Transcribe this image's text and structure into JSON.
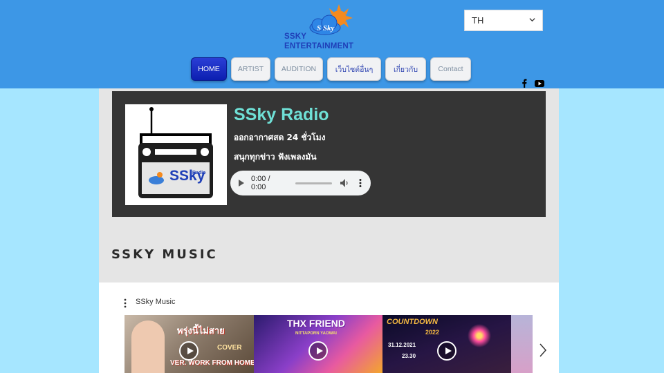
{
  "header": {
    "logo_badge": "S Sky",
    "logo_line1": "SSKY",
    "logo_line2": "ENTERTAINMENT",
    "language": "TH",
    "colors": {
      "header_bg": "#3d97e6",
      "active_nav": "#1a2fc4",
      "page_bg": "#a6e6ff"
    }
  },
  "nav": {
    "items": [
      {
        "label": "HOME",
        "active": true
      },
      {
        "label": "ARTIST"
      },
      {
        "label": "AUDITION"
      },
      {
        "label": "เว็บไซต์อื่นๆ"
      },
      {
        "label": "เกี่ยวกับ"
      },
      {
        "label": "Contact"
      }
    ]
  },
  "social": {
    "icons": [
      "facebook-icon",
      "youtube-icon"
    ]
  },
  "radio": {
    "title": "SSky Radio",
    "line1": "ออกอากาศสด 24 ชั่วโมง",
    "line2": "สนุกทุกข่าว ฟังเพลงมัน",
    "image_text": "SSky",
    "image_small_text": "Radio",
    "player_time": "0:00 / 0:00"
  },
  "music": {
    "section_title": "SSKY MUSIC",
    "playlist_label": "SSky Music",
    "videos": [
      {
        "title": "พรุ่งนี้ไม่สาย",
        "sub1": "COVER",
        "sub2": "VER. WORK FROM HOME"
      },
      {
        "title": "THX FRIEND",
        "sub1": "NITTAPORN YAOWAI"
      },
      {
        "title": "COUNTDOWN",
        "sub1": "2022",
        "sub2": "31.12.2021",
        "sub3": "23.30"
      },
      {
        "title": ""
      }
    ]
  }
}
